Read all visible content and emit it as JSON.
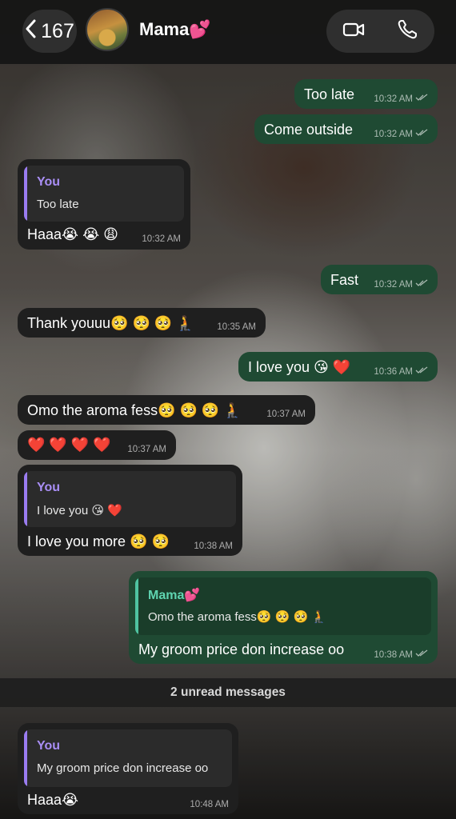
{
  "header": {
    "back_count": "167",
    "contact_name": "Mama💕"
  },
  "messages": {
    "m1": {
      "text": "Too late",
      "time": "10:32 AM"
    },
    "m2": {
      "text": "Come outside",
      "time": "10:32 AM"
    },
    "m3": {
      "reply_author": "You",
      "reply_text": "Too late",
      "text": "Haaa😭 😭 😩",
      "time": "10:32 AM"
    },
    "m4": {
      "text": "Fast",
      "time": "10:32 AM"
    },
    "m5": {
      "text": "Thank youuu🥺 🥺 🥺 🧎",
      "time": "10:35 AM"
    },
    "m6": {
      "text": "I love you 😘 ❤️",
      "time": "10:36 AM"
    },
    "m7": {
      "text": "Omo the aroma fess🥺 🥺 🥺 🧎",
      "time": "10:37 AM"
    },
    "m8": {
      "text": "❤️ ❤️ ❤️ ❤️",
      "time": "10:37 AM"
    },
    "m9": {
      "reply_author": "You",
      "reply_text": "I love you 😘 ❤️",
      "text": "I love you more 🥺 🥺",
      "time": "10:38 AM"
    },
    "m10": {
      "reply_author": "Mama💕",
      "reply_text": "Omo the aroma fess🥺 🥺 🥺 🧎",
      "text": "My groom price don increase oo",
      "time": "10:38 AM"
    },
    "m11": {
      "reply_author": "You",
      "reply_text": "My groom price don increase oo",
      "text": "Haaa😭",
      "time": "10:48 AM"
    }
  },
  "unread_label": "2 unread messages",
  "colors": {
    "outgoing_bubble": "#1f4a33",
    "incoming_bubble": "#1f1f1f",
    "reply_you_accent": "#9a7cf0",
    "reply_mama_accent": "#4fc3a1"
  },
  "icons": [
    "back-chevron-icon",
    "video-call-icon",
    "phone-call-icon",
    "double-check-icon"
  ]
}
